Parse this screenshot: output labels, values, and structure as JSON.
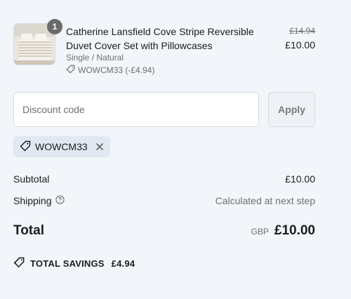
{
  "product": {
    "quantity": "1",
    "title": "Catherine Lansfield Cove Stripe Reversible Duvet Cover Set with Pillowcases",
    "variant": "Single / Natural",
    "discount_label": "WOWCM33 (-£4.94)",
    "original_price": "£14.94",
    "price": "£10.00"
  },
  "discount": {
    "placeholder": "Discount code",
    "apply_label": "Apply",
    "applied_code": "WOWCM33"
  },
  "summary": {
    "subtotal_label": "Subtotal",
    "subtotal_value": "£10.00",
    "shipping_label": "Shipping",
    "shipping_value": "Calculated at next step",
    "total_label": "Total",
    "currency": "GBP",
    "total_value": "£10.00"
  },
  "savings": {
    "label": "TOTAL SAVINGS",
    "amount": "£4.94"
  }
}
